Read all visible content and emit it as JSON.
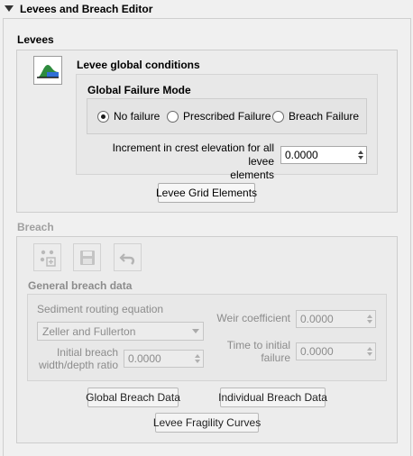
{
  "panel": {
    "title": "Levees and Breach Editor"
  },
  "levees": {
    "section_title": "Levees",
    "global_conditions_label": "Levee global conditions",
    "failure_mode": {
      "title": "Global Failure Mode",
      "options": [
        {
          "label": "No failure",
          "checked": true
        },
        {
          "label": "Prescribed Failure",
          "checked": false
        },
        {
          "label": "Breach Failure",
          "checked": false
        }
      ]
    },
    "increment_label_line1": "Increment in crest elevation for all levee",
    "increment_label_line2": "elements",
    "increment_value": "0.0000",
    "grid_button": "Levee Grid Elements"
  },
  "breach": {
    "section_title": "Breach",
    "general_title": "General breach data",
    "sediment_label": "Sediment routing equation",
    "sediment_value": "Zeller and Fullerton",
    "weir_label": "Weir coefficient",
    "weir_value": "0.0000",
    "initial_width_label_line1": "Initial breach",
    "initial_width_label_line2": "width/depth ratio",
    "initial_width_value": "0.0000",
    "time_label_line1": "Time to initial",
    "time_label_line2": "failure",
    "time_value": "0.0000",
    "global_button": "Global Breach Data",
    "individual_button": "Individual Breach Data",
    "fragility_button": "Levee Fragility Curves"
  },
  "icons": [
    "collapse-arrow-icon",
    "levee-profile-icon",
    "add-points-icon",
    "save-icon",
    "undo-icon"
  ]
}
